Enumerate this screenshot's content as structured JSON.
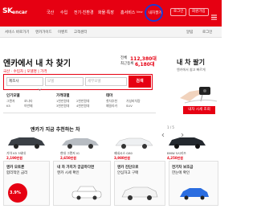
{
  "header": {
    "logo_sk": "SK",
    "logo_encar": "encar",
    "nav": [
      "국산",
      "수입",
      "전기·친환경",
      "화물·특장",
      "홈서비스",
      "내차팔기"
    ],
    "nav_badge": "New",
    "right": [
      "로그인",
      "회원가입",
      "더보기"
    ]
  },
  "subbar": {
    "items": [
      "서비스 바로가기",
      "엔카가이드",
      "이벤트",
      "고객센터"
    ],
    "right_items": [
      "알림",
      "로그인"
    ]
  },
  "find": {
    "title": "엔카에서 내 차 찾기",
    "total_label": "전체",
    "total_value": "112,380대",
    "recent_label": "최근등록",
    "recent_value": "6,180대",
    "search_tabs": "국산 · 수입차  |  모델명  |  가격",
    "maker_placeholder": "제조사",
    "model_placeholder": "모델",
    "detail_placeholder": "세부모델",
    "search_label": "검색",
    "columns": [
      {
        "head": "인기모델",
        "items": [
          "그랜저",
          "쏘나타",
          "K5",
          "아반떼"
        ]
      },
      {
        "head": "가격대별",
        "items": [
          "1천만원대",
          "2천만원대",
          "3천만원대",
          "4천만원대"
        ]
      },
      {
        "head": "테마",
        "items": [
          "첫차추천",
          "가성비차량",
          "패밀리카",
          "SUV"
        ]
      }
    ]
  },
  "sell": {
    "title": "내 차 팔기",
    "subtitle": "엔카에서 쉽고 빠르게",
    "button": "내차 시세 조회"
  },
  "rec": {
    "title": "엔카가 지금 추천하는 차",
    "pager": "1 / 5",
    "cars": [
      {
        "name": "기아 K5 3세대",
        "price": "2,190만원"
      },
      {
        "name": "현대 그랜저 IG",
        "price": "2,650만원"
      },
      {
        "name": "제네시스 G80",
        "price": "3,980만원"
      },
      {
        "name": "BMW 5시리즈",
        "price": "4,250만원"
      }
    ]
  },
  "banners": [
    {
      "line1": "엔카 오토론",
      "line2": "합리적인 금리",
      "rate": "3.9%"
    },
    {
      "line1": "내 차 가치가 궁금하다면",
      "line2": "엔카 시세 확인"
    },
    {
      "line1": "엔카 진단으로",
      "line2": "안심하고 구매"
    },
    {
      "line1": "전기차 보조금",
      "line2": "한눈에 확인"
    }
  ],
  "colors": {
    "brand": "#e60012",
    "annotation": "#1a3ad4"
  }
}
